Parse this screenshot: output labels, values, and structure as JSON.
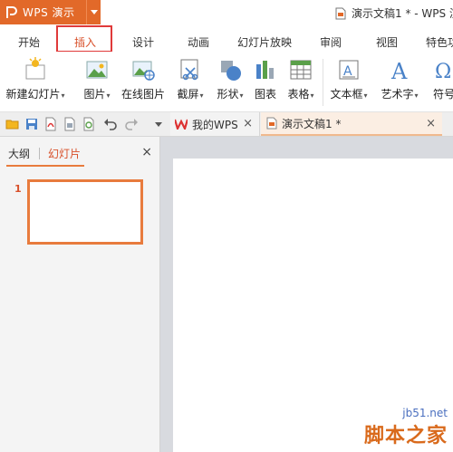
{
  "app": {
    "name": "WPS 演示",
    "doc_title": "演示文稿1 * - WPS 演"
  },
  "tabs": [
    {
      "label": "开始"
    },
    {
      "label": "插入"
    },
    {
      "label": "设计"
    },
    {
      "label": "动画"
    },
    {
      "label": "幻灯片放映"
    },
    {
      "label": "审阅"
    },
    {
      "label": "视图"
    },
    {
      "label": "特色功"
    }
  ],
  "active_tab": "插入",
  "ribbon": {
    "new_slide": "新建幻灯片",
    "picture": "图片",
    "online_picture": "在线图片",
    "screenshot": "截屏",
    "shape": "形状",
    "chart": "图表",
    "table": "表格",
    "textbox": "文本框",
    "wordart": "艺术字",
    "symbol": "符号"
  },
  "doc_tabs": {
    "wps": "我的WPS",
    "doc": "演示文稿1 *",
    "close": "×"
  },
  "panel": {
    "outline_tab": "大纲",
    "slides_tab": "幻灯片",
    "close": "×",
    "slide_number": "1"
  },
  "watermark": {
    "site": "jb51.net",
    "brand": "脚本之家"
  },
  "colors": {
    "accent": "#e26929",
    "active_tab_outline": "#e03a3a",
    "active_text": "#d8502a",
    "workspace_bg": "#d8dadf"
  }
}
